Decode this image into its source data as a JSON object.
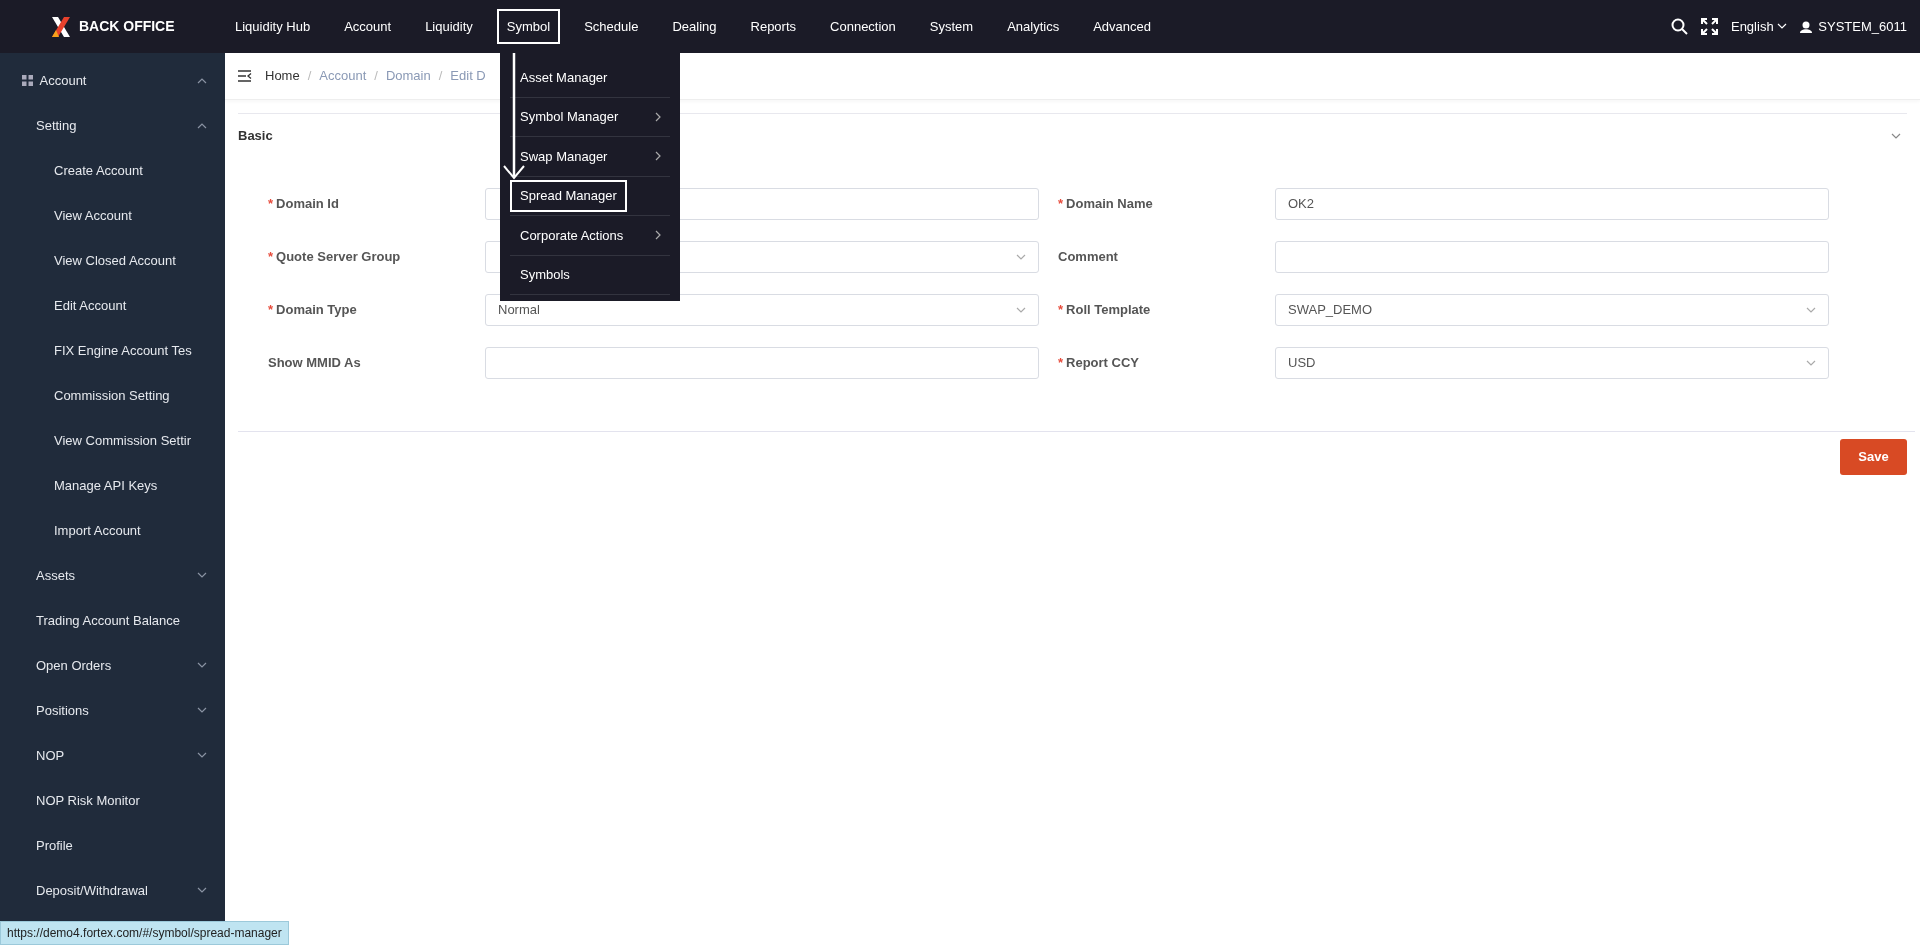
{
  "app": {
    "title": "BACK OFFICE"
  },
  "nav": [
    {
      "label": "Liquidity Hub",
      "highlighted": false
    },
    {
      "label": "Account",
      "highlighted": false
    },
    {
      "label": "Liquidity",
      "highlighted": false
    },
    {
      "label": "Symbol",
      "highlighted": true
    },
    {
      "label": "Schedule",
      "highlighted": false
    },
    {
      "label": "Dealing",
      "highlighted": false
    },
    {
      "label": "Reports",
      "highlighted": false
    },
    {
      "label": "Connection",
      "highlighted": false
    },
    {
      "label": "System",
      "highlighted": false
    },
    {
      "label": "Analytics",
      "highlighted": false
    },
    {
      "label": "Advanced",
      "highlighted": false
    }
  ],
  "header_tools": {
    "language": "English",
    "user": "SYSTEM_6011"
  },
  "dropdown": {
    "items": [
      {
        "label": "Asset Manager",
        "has_submenu": false,
        "highlighted": false
      },
      {
        "label": "Symbol Manager",
        "has_submenu": true,
        "highlighted": false
      },
      {
        "label": "Swap Manager",
        "has_submenu": true,
        "highlighted": false
      },
      {
        "label": "Spread Manager",
        "has_submenu": false,
        "highlighted": true
      },
      {
        "label": "Corporate Actions",
        "has_submenu": true,
        "highlighted": false
      },
      {
        "label": "Symbols",
        "has_submenu": false,
        "highlighted": false
      }
    ]
  },
  "sidebar": {
    "items": [
      {
        "label": "Account",
        "kind": "group",
        "expanded": true,
        "children": [
          {
            "label": "Setting",
            "kind": "group",
            "expanded": true,
            "children": [
              {
                "label": "Create Account",
                "kind": "link"
              },
              {
                "label": "View Account",
                "kind": "link"
              },
              {
                "label": "View Closed Account",
                "kind": "link"
              },
              {
                "label": "Edit Account",
                "kind": "link"
              },
              {
                "label": "FIX Engine Account Tes",
                "kind": "link"
              },
              {
                "label": "Commission Setting",
                "kind": "link"
              },
              {
                "label": "View Commission Settir",
                "kind": "link"
              },
              {
                "label": "Manage API Keys",
                "kind": "link"
              },
              {
                "label": "Import Account",
                "kind": "link"
              }
            ]
          },
          {
            "label": "Assets",
            "kind": "group",
            "expanded": false
          },
          {
            "label": "Trading Account Balance",
            "kind": "link"
          },
          {
            "label": "Open Orders",
            "kind": "group",
            "expanded": false
          },
          {
            "label": "Positions",
            "kind": "group",
            "expanded": false
          },
          {
            "label": "NOP",
            "kind": "group",
            "expanded": false
          },
          {
            "label": "NOP Risk Monitor",
            "kind": "link"
          },
          {
            "label": "Profile",
            "kind": "link"
          },
          {
            "label": "Deposit/Withdrawal",
            "kind": "group",
            "expanded": false
          }
        ]
      }
    ]
  },
  "breadcrumb": {
    "separator": "/",
    "items": [
      "Home",
      "Account",
      "Domain",
      "Edit D"
    ]
  },
  "section": {
    "title": "Basic",
    "expanded": true,
    "required_mark": "*",
    "fields": [
      {
        "label": "Domain Id",
        "required": true,
        "kind": "text"
      },
      {
        "label": "Domain Name",
        "required": true,
        "kind": "text",
        "value": "OK2"
      },
      {
        "label": "Quote Server Group",
        "required": true,
        "kind": "select"
      },
      {
        "label": "Comment",
        "required": false,
        "kind": "text"
      },
      {
        "label": "Domain Type",
        "required": true,
        "kind": "select",
        "value": "Normal"
      },
      {
        "label": "Roll Template",
        "required": true,
        "kind": "select",
        "value": "SWAP_DEMO"
      },
      {
        "label": "Show MMID As",
        "required": false,
        "kind": "text"
      },
      {
        "label": "Report CCY",
        "required": true,
        "kind": "select",
        "value": "USD"
      }
    ]
  },
  "save_button": "Save",
  "status_bar": {
    "url": "https://demo4.fortex.com/#/symbol/spread-manager"
  }
}
